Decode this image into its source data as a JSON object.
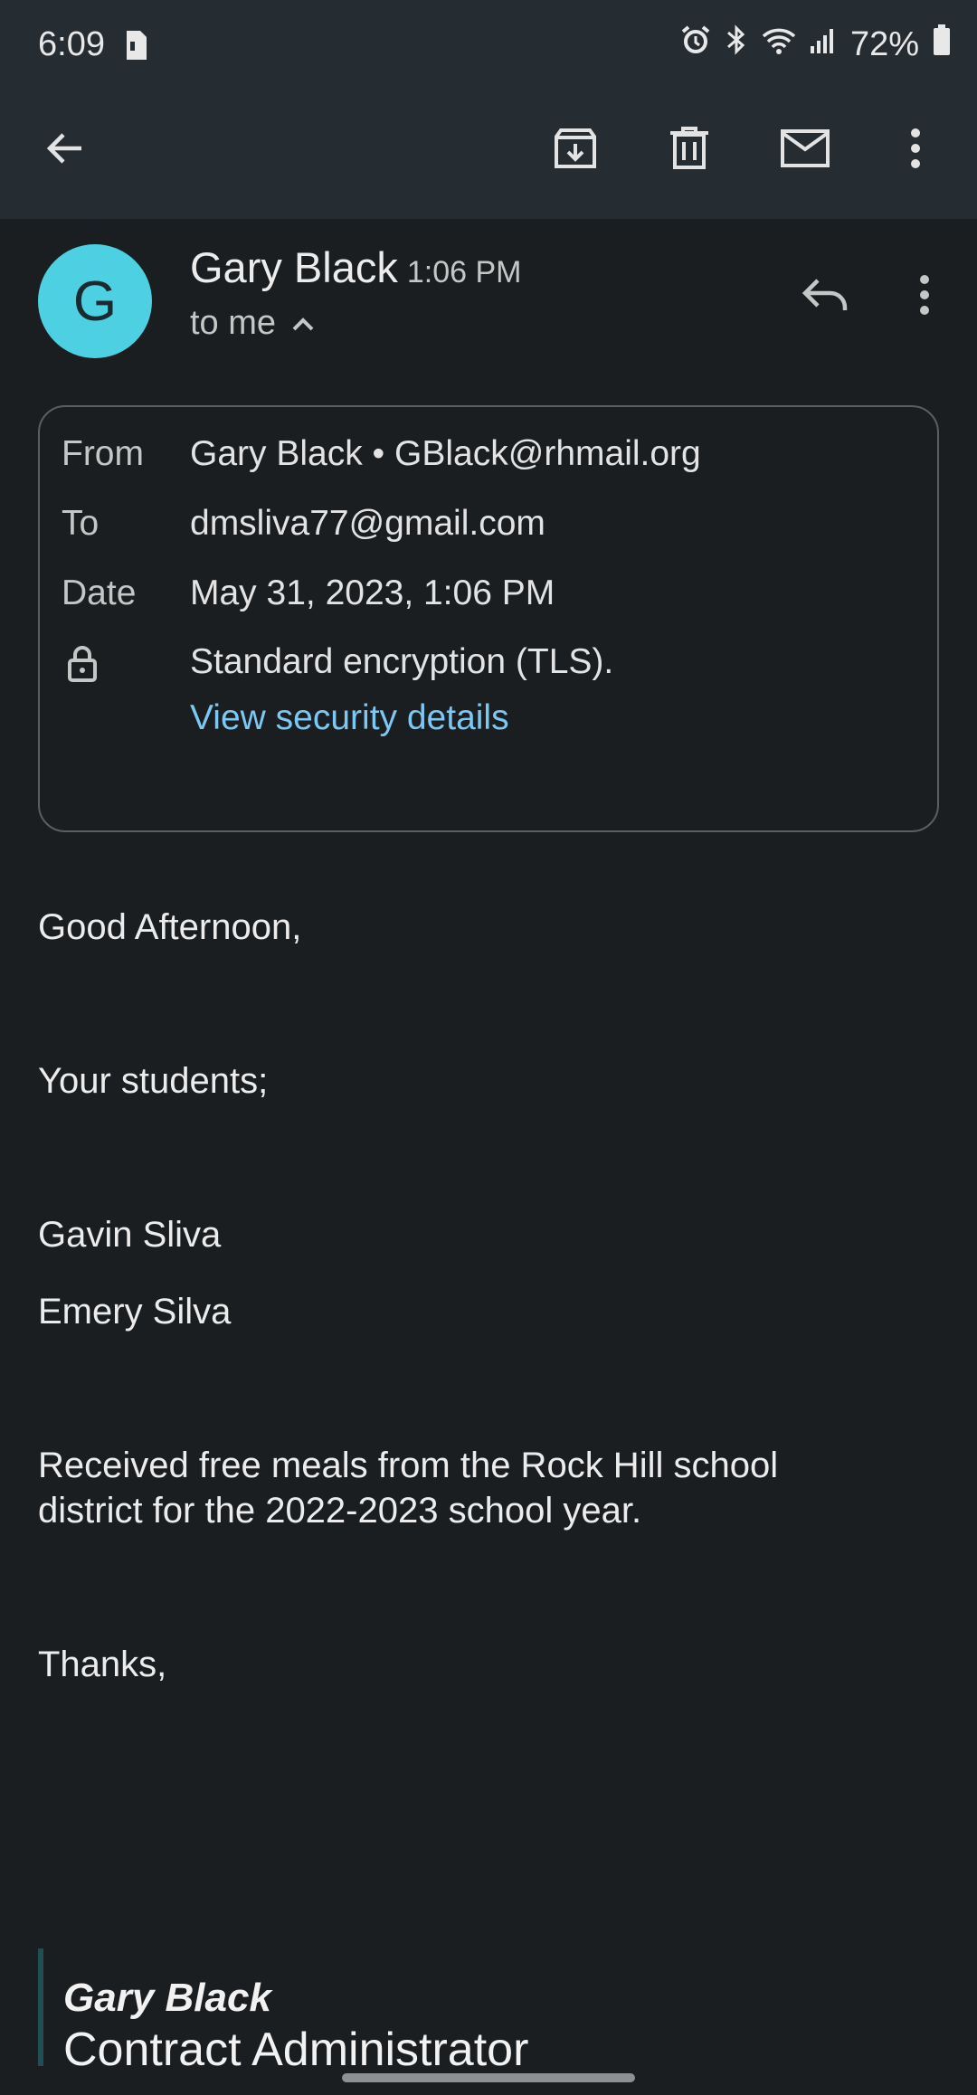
{
  "status_bar": {
    "time": "6:09",
    "battery": "72%"
  },
  "toolbar": {
    "icons": [
      "back-arrow-icon",
      "archive-icon",
      "delete-icon",
      "mark-unread-icon",
      "more-vert-icon"
    ]
  },
  "email": {
    "sender": "Gary Black",
    "avatar_letter": "G",
    "avatar_color": "#4dd0e1",
    "time": "1:06 PM",
    "recipient_summary": "to me",
    "details": {
      "from_label": "From",
      "from_value": "Gary Black • GBlack@rhmail.org",
      "to_label": "To",
      "to_value": "dmsliva77@gmail.com",
      "date_label": "Date",
      "date_value": "May 31, 2023, 1:06 PM",
      "encryption": "Standard encryption (TLS).",
      "security_link": "View security details"
    },
    "body": {
      "greeting": "Good Afternoon,",
      "line1": "Your students;",
      "student1": "Gavin Sliva",
      "student2": "Emery Silva",
      "message_line1": "Received free meals from the Rock Hill school",
      "message_line2": "district for the 2022-2023 school year.",
      "closing": "Thanks,"
    },
    "signature": {
      "name": "Gary Black",
      "title": "Contract Administrator"
    }
  },
  "colors": {
    "background": "#1b1e21",
    "toolbar": "#252c32",
    "link": "#7cc8f2"
  }
}
